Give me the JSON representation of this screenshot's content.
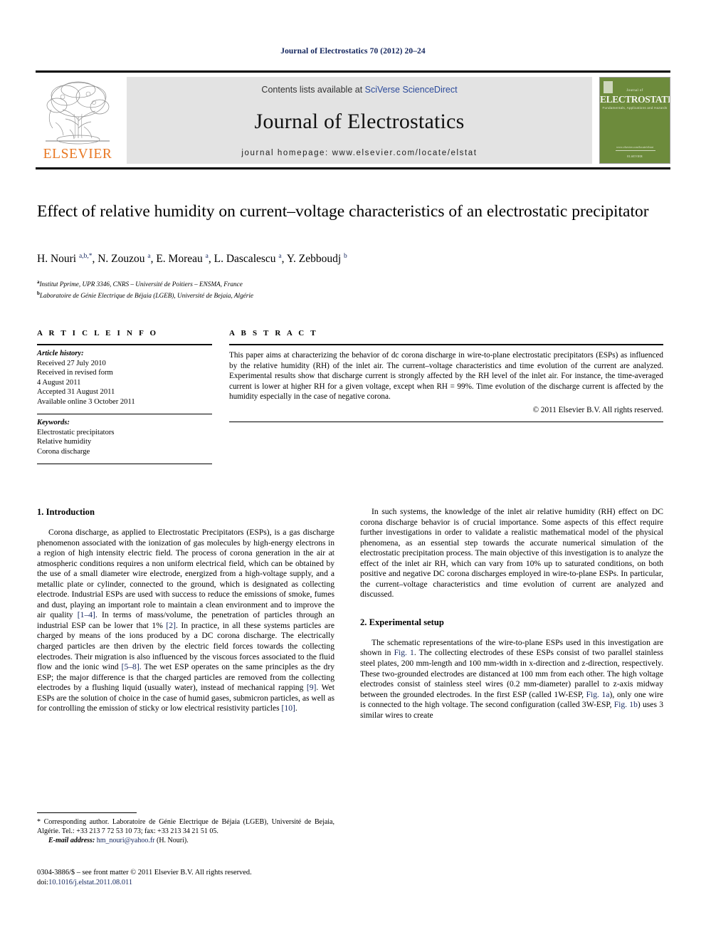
{
  "running_head": "Journal of Electrostatics 70 (2012) 20–24",
  "masthead": {
    "publisher_logo_text": "ELSEVIER",
    "contents_prefix": "Contents lists available at ",
    "contents_link": "SciVerse ScienceDirect",
    "journal_title": "Journal of Electrostatics",
    "homepage": "journal homepage: www.elsevier.com/locate/elstat",
    "cover": {
      "small_top": "Journal of",
      "title": "ELECTROSTATICS",
      "subtitle": "Fundamentals, Applications and Hazards",
      "bottom_brand": "ELSEVIER",
      "bottom_url": "www.elsevier.com/locate/elstat"
    }
  },
  "article": {
    "title": "Effect of relative humidity on current–voltage characteristics of an electrostatic precipitator",
    "authors_html": "H. Nouri <sup>a,b,</sup><sup>*</sup>, N. Zouzou <sup>a</sup>, E. Moreau <sup>a</sup>, L. Dascalescu <sup>a</sup>, Y. Zebboudj <sup>b</sup>",
    "affiliation_a": "Institut Pprime, UPR 3346, CNRS – Université de Poitiers – ENSMA, France",
    "affiliation_b": "Laboratoire de Génie Electrique de Béjaia (LGEB), Université de Bejaia, Algérie"
  },
  "info": {
    "heading": "A R T I C L E  I N F O",
    "history_label": "Article history:",
    "history": [
      "Received 27 July 2010",
      "Received in revised form",
      "4 August 2011",
      "Accepted 31 August 2011",
      "Available online 3 October 2011"
    ],
    "keywords_label": "Keywords:",
    "keywords": [
      "Electrostatic precipitators",
      "Relative humidity",
      "Corona discharge"
    ]
  },
  "abstract": {
    "heading": "A B S T R A C T",
    "text": "This paper aims at characterizing the behavior of dc corona discharge in wire-to-plane electrostatic precipitators (ESPs) as influenced by the relative humidity (RH) of the inlet air. The current–voltage characteristics and time evolution of the current are analyzed. Experimental results show that discharge current is strongly affected by the RH level of the inlet air. For instance, the time-averaged current is lower at higher RH for a given voltage, except when RH = 99%. Time evolution of the discharge current is affected by the humidity especially in the case of negative corona.",
    "copyright": "© 2011 Elsevier B.V. All rights reserved."
  },
  "sections": {
    "intro_heading": "1. Introduction",
    "intro_p1_a": "Corona discharge, as applied to Electrostatic Precipitators (ESPs), is a gas discharge phenomenon associated with the ionization of gas molecules by high-energy electrons in a region of high intensity electric field. The process of corona generation in the air at atmospheric conditions requires a non uniform electrical field, which can be obtained by the use of a small diameter wire electrode, energized from a high-voltage supply, and a metallic plate or cylinder, connected to the ground, which is designated as collecting electrode. Industrial ESPs are used with success to reduce the emissions of smoke, fumes and dust, playing an important role to maintain a clean environment and to improve the air quality ",
    "ref_1_4": "[1–4]",
    "intro_p1_b": ". In terms of mass/volume, the penetration of particles through an industrial ESP can be lower that 1% ",
    "ref_2": "[2]",
    "intro_p1_c": ". In practice, in all these systems particles are charged by means of the ions produced by a DC corona discharge. The electrically charged particles are then driven by the electric field forces towards the collecting electrodes. Their migration is also influenced by the viscous forces associated to the fluid flow and the ionic wind ",
    "ref_5_8": "[5–8]",
    "intro_p1_d": ". The wet ESP operates on the same principles as the dry ESP; the major difference is that the charged particles are removed from the collecting electrodes by a flushing liquid (usually water), instead of mechanical rapping ",
    "ref_9": "[9]",
    "intro_p1_e": ". Wet ESPs are the solution of choice in the case of humid gases, submicron particles, as well as for controlling the emission of sticky or low electrical resistivity particles ",
    "ref_10": "[10]",
    "intro_p1_f": ".",
    "intro_p2": "In such systems, the knowledge of the inlet air relative humidity (RH) effect on DC corona discharge behavior is of crucial importance. Some aspects of this effect require further investigations in order to validate a realistic mathematical model of the physical phenomena, as an essential step towards the accurate numerical simulation of the electrostatic precipitation process. The main objective of this investigation is to analyze the effect of the inlet air RH, which can vary from 10% up to saturated conditions, on both positive and negative DC corona discharges employed in wire-to-plane ESPs. In particular, the current–voltage characteristics and time evolution of current are analyzed and discussed.",
    "setup_heading": "2. Experimental setup",
    "setup_p1_a": "The schematic representations of the wire-to-plane ESPs used in this investigation are shown in ",
    "fig1_link": "Fig. 1",
    "setup_p1_b": ". The collecting electrodes of these ESPs consist of two parallel stainless steel plates, 200 mm-length and 100 mm-width in x-direction and z-direction, respectively. These two-grounded electrodes are distanced at 100 mm from each other. The high voltage electrodes consist of stainless steel wires (0.2 mm-diameter) parallel to z-axis midway between the grounded electrodes. In the first ESP (called 1W-ESP, ",
    "fig1a_link": "Fig. 1a",
    "setup_p1_c": "), only one wire is connected to the high voltage. The second configuration (called 3W-ESP, ",
    "fig1b_link": "Fig. 1b",
    "setup_p1_d": ") uses 3 similar wires to create"
  },
  "footnotes": {
    "corresponding": "* Corresponding author. Laboratoire de Génie Electrique de Béjaia (LGEB), Université de Bejaia, Algérie. Tel.: +33 213 7 72 53 10 73; fax: +33 213 34 21 51 05.",
    "email_label": "E-mail address:",
    "email": "hm_nouri@yahoo.fr",
    "email_suffix": " (H. Nouri).",
    "issn_line": "0304-3886/$ – see front matter © 2011 Elsevier B.V. All rights reserved.",
    "doi_label": "doi:",
    "doi": "10.1016/j.elstat.2011.08.011"
  },
  "colors": {
    "link_blue": "#12245c",
    "sciencedirect_blue": "#2b4a9b",
    "elsevier_orange": "#E87722",
    "masthead_gray": "#e3e3e3",
    "cover_green": "#6d8b3c"
  }
}
